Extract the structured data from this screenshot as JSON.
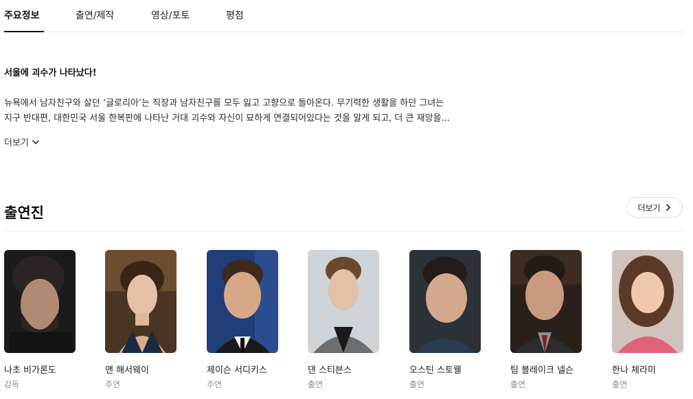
{
  "tabs": [
    {
      "label": "주요정보",
      "active": true
    },
    {
      "label": "출연/제작",
      "active": false
    },
    {
      "label": "영상/포토",
      "active": false
    },
    {
      "label": "평점",
      "active": false
    }
  ],
  "overview": {
    "headline": "서울에 괴수가 나타났다!",
    "synopsis_lines": [
      "뉴욕에서 남자친구와 살던 ‘글로리아’는 직장과 남자친구를 모두 잃고 고향으로 돌아온다. 무기력한 생활을 하던 그녀는",
      "지구 반대편, 대한민국 서울 한복판에 나타난 거대 괴수와 자신이 묘하게 연결되어있다는 것을 알게 되고, 더 큰 재앙을..."
    ],
    "more_label": "더보기",
    "more_icon": "chevron-down-icon"
  },
  "cast_section": {
    "title": "출연진",
    "more_label": "더보기",
    "more_icon": "chevron-right-icon",
    "members": [
      {
        "name": "나초 비가론도",
        "role": "감독"
      },
      {
        "name": "앤 해서웨이",
        "role": "주연"
      },
      {
        "name": "제이슨 서디키스",
        "role": "주연"
      },
      {
        "name": "댄 스티븐스",
        "role": "출연"
      },
      {
        "name": "오스틴 스토웰",
        "role": "출연"
      },
      {
        "name": "팀 블레이크 넬슨",
        "role": "출연"
      },
      {
        "name": "한나 체라미",
        "role": "출연"
      }
    ]
  },
  "colors": {
    "text_primary": "#141414",
    "text_secondary": "#8c8c8c",
    "divider": "#e6e6e6"
  }
}
